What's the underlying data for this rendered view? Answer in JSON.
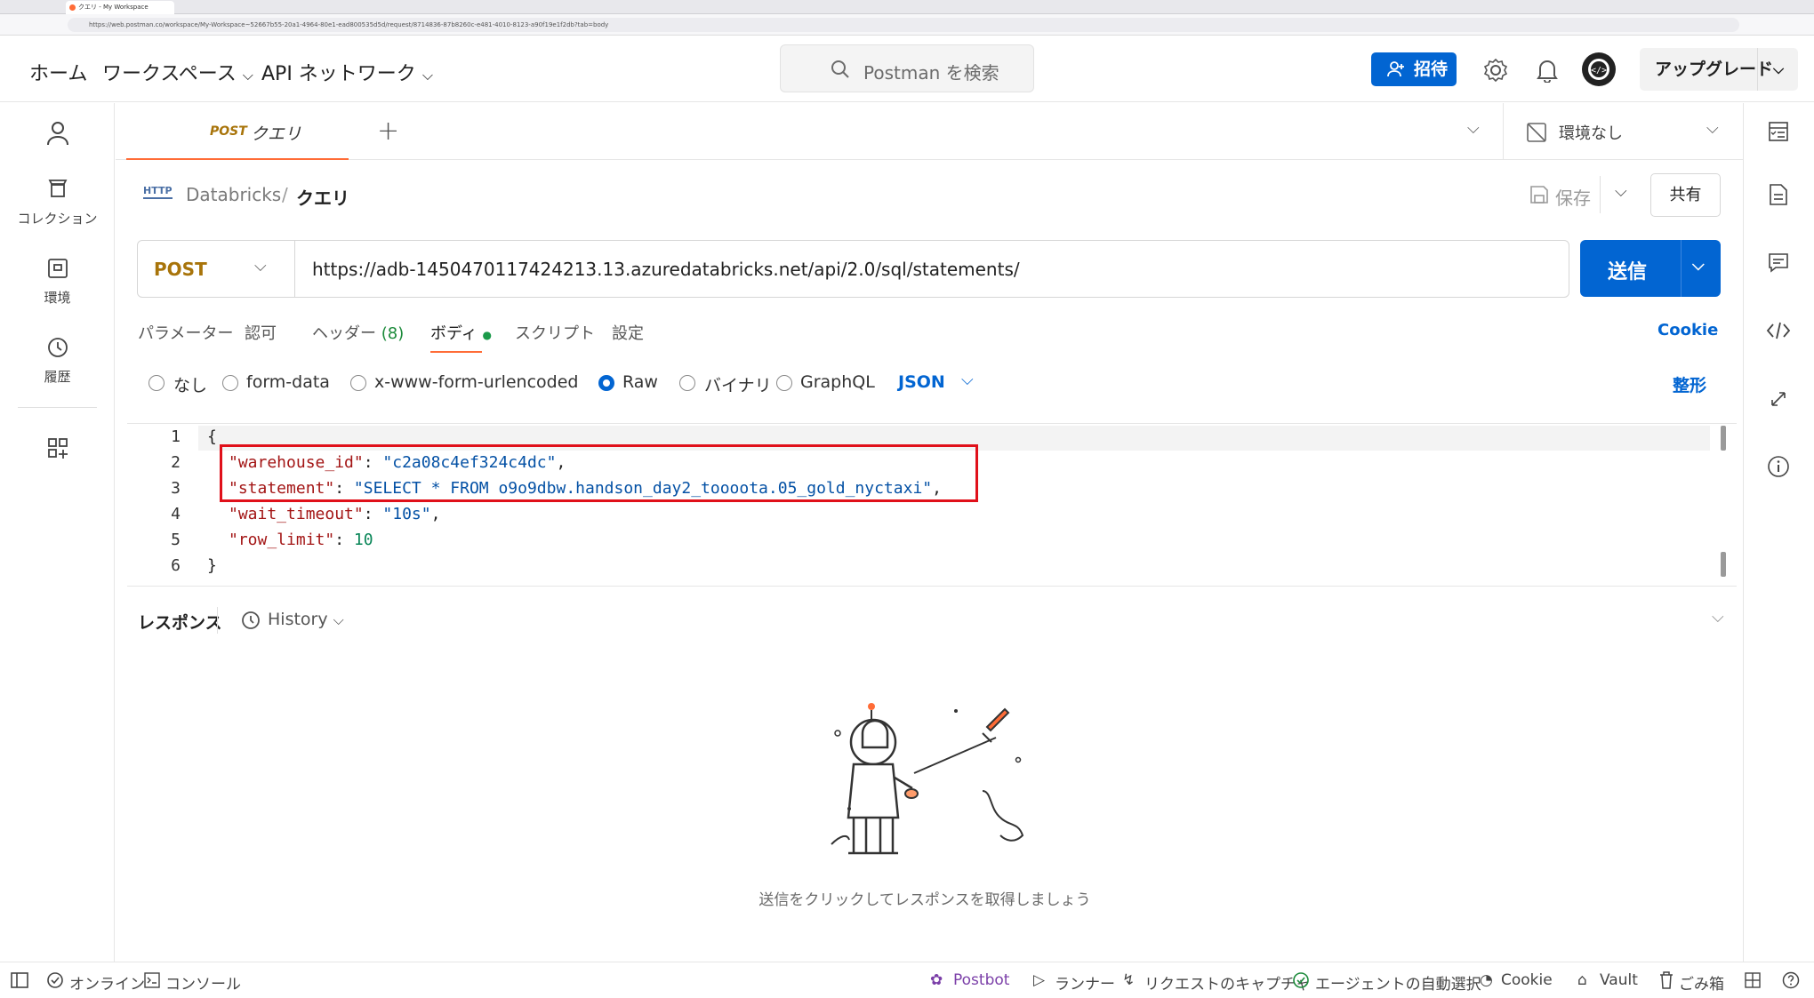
{
  "browser": {
    "tab_title": "クエリ - My Workspace",
    "url": "https://web.postman.co/workspace/My-Workspace~52667b55-20a1-4964-80e1-ead800535d5d/request/8714836-87b8260c-e481-4010-8123-a90f19e1f2db?tab=body"
  },
  "header": {
    "nav_home": "ホーム",
    "nav_workspaces": "ワークスペース",
    "nav_api_network": "API ネットワーク",
    "search_placeholder": "Postman を検索",
    "invite_label": "招待",
    "upgrade_label": "アップグレード"
  },
  "sidebar": {
    "collections": "コレクション",
    "environments": "環境",
    "history": "履歴"
  },
  "tabs": {
    "active_method": "POST",
    "active_name": "クエリ",
    "environment": "環境なし"
  },
  "breadcrumb": {
    "collection": "Databricks",
    "separator": "/",
    "request": "クエリ",
    "save_label": "保存",
    "share_label": "共有"
  },
  "request": {
    "method": "POST",
    "url": "https://adb-1450470117424213.13.azuredatabricks.net/api/2.0/sql/statements/",
    "send_label": "送信"
  },
  "subtabs": {
    "params": "パラメーター",
    "auth": "認可",
    "headers": "ヘッダー",
    "headers_count": "(8)",
    "body": "ボディ",
    "scripts": "スクリプト",
    "settings": "設定",
    "cookies": "Cookie"
  },
  "body_types": {
    "none": "なし",
    "form_data": "form-data",
    "urlencoded": "x-www-form-urlencoded",
    "raw": "Raw",
    "binary": "バイナリ",
    "graphql": "GraphQL",
    "format": "JSON",
    "beautify": "整形"
  },
  "editor": {
    "line_numbers": [
      "1",
      "2",
      "3",
      "4",
      "5",
      "6"
    ],
    "open_brace": "{",
    "close_brace": "}",
    "k1": "\"warehouse_id\"",
    "v1": "\"c2a08c4ef324c4dc\"",
    "k2": "\"statement\"",
    "v2": "\"SELECT * FROM o9o9dbw.handson_day2_toooota.05_gold_nyctaxi\"",
    "k3": "\"wait_timeout\"",
    "v3": "\"10s\"",
    "k4": "\"row_limit\"",
    "v4": "10"
  },
  "response": {
    "title": "レスポンス",
    "history": "History",
    "empty_message": "送信をクリックしてレスポンスを取得しましょう"
  },
  "statusbar": {
    "online": "オンライン",
    "console": "コンソール",
    "postbot": "Postbot",
    "runner": "ランナー",
    "capture": "リクエストのキャプチャ",
    "agent": "エージェントの自動選択",
    "cookie": "Cookie",
    "vault": "Vault",
    "trash": "ごみ箱"
  },
  "colors": {
    "brand_orange": "#ff6c37",
    "primary_blue": "#0265d2",
    "method_post": "#a8740a",
    "highlight_red": "#e0101a"
  }
}
